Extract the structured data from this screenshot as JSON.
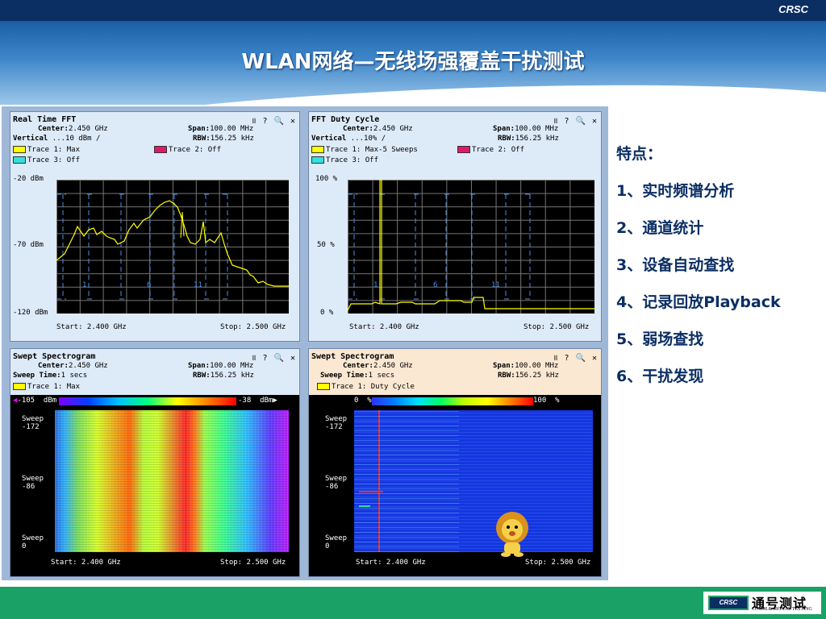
{
  "brand": "CRSC",
  "title": "WLAN网络—无线场强覆盖干扰测试",
  "controls": "॥ ? 🔍 ✕",
  "panels": {
    "fft": {
      "title": "Real Time FFT",
      "center_label": "Center:",
      "center": "2.450 GHz",
      "span_label": "Span:",
      "span": "100.00 MHz",
      "vertical_label": "Vertical",
      "vertical": " ...10 dBm /",
      "rbw_label": "RBW:",
      "rbw": "156.25 kHz",
      "trace1": "Trace 1: Max",
      "trace2": "Trace 2: Off",
      "trace3": "Trace 3: Off",
      "y_top": "-20 dBm",
      "y_mid": "-70 dBm",
      "y_bot": "-120 dBm",
      "channels": [
        "1",
        "6",
        "11"
      ],
      "start": "Start: 2.400 GHz",
      "stop": "Stop: 2.500 GHz"
    },
    "duty": {
      "title": "FFT Duty Cycle",
      "center_label": "Center:",
      "center": "2.450 GHz",
      "span_label": "Span:",
      "span": "100.00 MHz",
      "vertical_label": "Vertical",
      "vertical": " ...10% /",
      "rbw_label": "RBW:",
      "rbw": "156.25 kHz",
      "trace1": "Trace 1: Max-5 Sweeps",
      "trace2": "Trace 2: Off",
      "trace3": "Trace 3: Off",
      "y_top": "100 %",
      "y_mid": "50 %",
      "y_bot": "0 %",
      "channels": [
        "1",
        "6",
        "11"
      ],
      "start": "Start: 2.400 GHz",
      "stop": "Stop: 2.500 GHz"
    },
    "spectro1": {
      "title": "Swept Spectrogram",
      "center_label": "Center:",
      "center": "2.450 GHz",
      "span_label": "Span:",
      "span": "100.00 MHz",
      "sweep_label": "Sweep Time:",
      "sweep_time": "1 secs",
      "rbw_label": "RBW:",
      "rbw": "156.25 kHz",
      "trace1": "Trace 1: Max",
      "scale_min": "-105  dBm",
      "scale_max": "-38  dBm",
      "sweeps": [
        "Sweep\n-172",
        "Sweep\n-86",
        "Sweep\n0"
      ],
      "start": "Start: 2.400 GHz",
      "stop": "Stop: 2.500 GHz"
    },
    "spectro2": {
      "title": "Swept Spectrogram",
      "center_label": "Center:",
      "center": "2.450 GHz",
      "span_label": "Span:",
      "span": "100.00 MHz",
      "sweep_label": "Sweep Time:",
      "sweep_time": "1 secs",
      "rbw_label": "RBW:",
      "rbw": "156.25 kHz",
      "trace1": "Trace 1: Duty Cycle",
      "scale_min": "0  %",
      "scale_max": "100  %",
      "sweeps": [
        "Sweep\n-172",
        "Sweep\n-86",
        "Sweep\n0"
      ],
      "start": "Start: 2.400 GHz",
      "stop": "Stop: 2.500 GHz"
    }
  },
  "features": [
    "特点：",
    "1、实时频谱分析",
    "2、通道统计",
    "3、设备自动查找",
    "4、记录回放Playback",
    "5、弱场查找",
    "6、干扰发现"
  ],
  "footer_logo": {
    "badge": "CRSC",
    "cn": "通号测试",
    "en": "COMM.& SIGNAL TESTING"
  },
  "colors": {
    "navy": "#0b2e63",
    "green": "#1aa266",
    "trace": "#ffff00",
    "trace2": "#e0196b",
    "trace3": "#33e0e0"
  }
}
